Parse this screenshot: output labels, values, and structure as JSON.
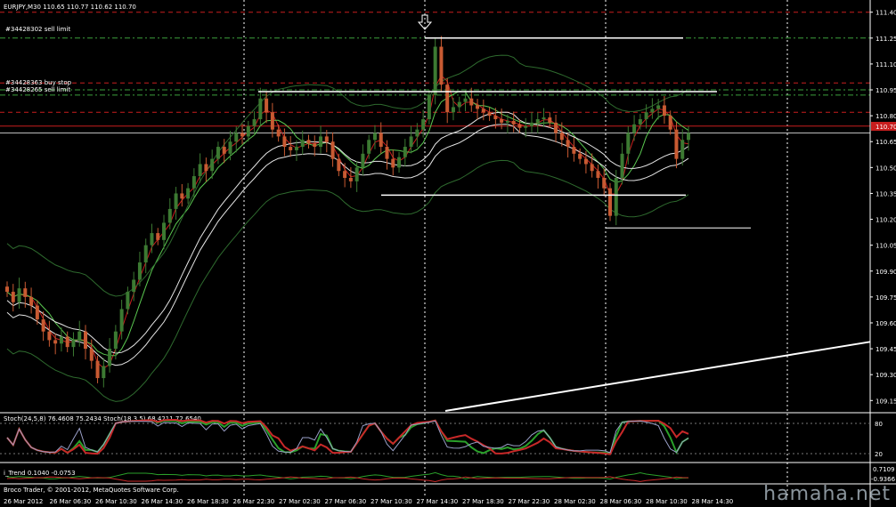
{
  "window": {
    "symbol_header": "EURJPY,M30  110.65 110.77 110.62 110.70",
    "copyright": "Broco Trader, © 2001-2012, MetaQuotes Software Corp.",
    "watermark": "hamaha.net"
  },
  "order_labels": [
    {
      "text": "#34428302 sell limit",
      "price": 111.25
    },
    {
      "text": "#34428363 buy stop",
      "price": 110.95
    },
    {
      "text": "#34428265 sell limit",
      "price": 110.92
    }
  ],
  "indicators": {
    "stoch_label": "Stoch(24,5,8) 76.4608 75.2434  Stoch(18,3,5) 68.4211 72.6540",
    "stoch_levels": [
      "80",
      "20"
    ],
    "trend_label": "i_Trend 0.1040 -0.0753",
    "trend_levels": [
      "0.7109",
      "-0.9366"
    ]
  },
  "colors": {
    "bull": "#3c7a32",
    "bear": "#c85a32",
    "red_line": "#c81e1e",
    "green_line": "#5ac850",
    "white_line": "#e6e6e6",
    "order_line": "#3ca03c",
    "current_price_box": "#c81e1e"
  },
  "chart_data": {
    "type": "candlestick",
    "symbol": "EURJPY",
    "timeframe": "M30",
    "ohlc_header": {
      "open": 110.65,
      "high": 110.77,
      "low": 110.62,
      "close": 110.7
    },
    "y_ticks": [
      "111.40",
      "111.25",
      "111.10",
      "110.95",
      "110.80",
      "110.65",
      "110.50",
      "110.35",
      "110.20",
      "110.05",
      "109.90",
      "109.75",
      "109.60",
      "109.45",
      "109.30",
      "109.15"
    ],
    "current_price": "110.70",
    "ylim": [
      109.1,
      111.45
    ],
    "x_ticks": [
      "26 Mar 2012",
      "26 Mar 06:30",
      "26 Mar 10:30",
      "26 Mar 14:30",
      "26 Mar 18:30",
      "26 Mar 22:30",
      "27 Mar 02:30",
      "27 Mar 06:30",
      "27 Mar 10:30",
      "27 Mar 14:30",
      "27 Mar 18:30",
      "27 Mar 22:30",
      "28 Mar 02:30",
      "28 Mar 06:30",
      "28 Mar 10:30",
      "28 Mar 14:30"
    ],
    "closes": [
      109.78,
      109.72,
      109.8,
      109.75,
      109.7,
      109.62,
      109.55,
      109.5,
      109.48,
      109.52,
      109.46,
      109.5,
      109.55,
      109.45,
      109.38,
      109.28,
      109.35,
      109.45,
      109.55,
      109.68,
      109.78,
      109.85,
      109.95,
      110.05,
      110.12,
      110.08,
      110.18,
      110.26,
      110.35,
      110.32,
      110.38,
      110.45,
      110.52,
      110.48,
      110.55,
      110.62,
      110.58,
      110.65,
      110.7,
      110.68,
      110.74,
      110.78,
      110.9,
      110.82,
      110.72,
      110.68,
      110.62,
      110.6,
      110.62,
      110.66,
      110.64,
      110.62,
      110.68,
      110.65,
      110.55,
      110.48,
      110.44,
      110.42,
      110.5,
      110.58,
      110.66,
      110.7,
      110.62,
      110.55,
      110.5,
      110.56,
      110.62,
      110.68,
      110.72,
      110.78,
      110.92,
      111.2,
      110.98,
      110.82,
      110.85,
      110.88,
      110.9,
      110.86,
      110.84,
      110.82,
      110.8,
      110.78,
      110.76,
      110.77,
      110.75,
      110.73,
      110.74,
      110.76,
      110.78,
      110.79,
      110.76,
      110.7,
      110.66,
      110.62,
      110.58,
      110.55,
      110.52,
      110.48,
      110.44,
      110.38,
      110.22,
      110.44,
      110.58,
      110.7,
      110.75,
      110.78,
      110.82,
      110.84,
      110.86,
      110.8,
      110.72,
      110.55,
      110.66,
      110.7
    ]
  }
}
